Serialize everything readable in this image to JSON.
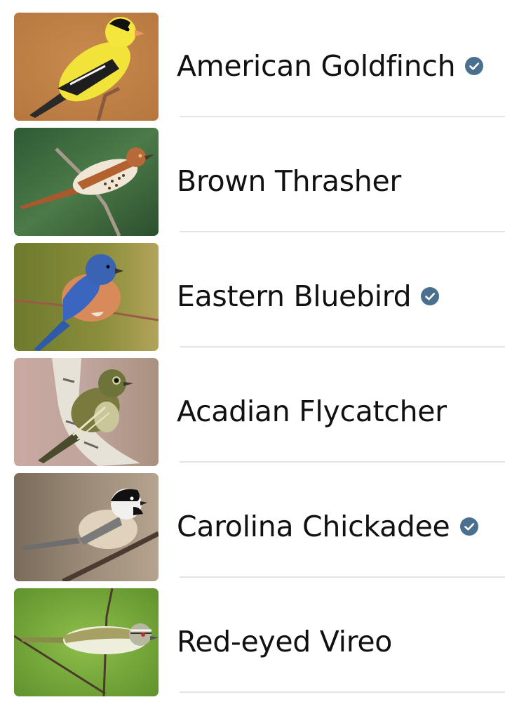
{
  "colors": {
    "verified_badge": "#4a6f8f",
    "separator": "#e4e4e7",
    "text": "#111111"
  },
  "birds": [
    {
      "name": "American Goldfinch",
      "verified": true,
      "photo": "goldfinch-photo"
    },
    {
      "name": "Brown Thrasher",
      "verified": false,
      "photo": "thrasher-photo"
    },
    {
      "name": "Eastern Bluebird",
      "verified": true,
      "photo": "bluebird-photo"
    },
    {
      "name": "Acadian Flycatcher",
      "verified": false,
      "photo": "flycatcher-photo"
    },
    {
      "name": "Carolina Chickadee",
      "verified": true,
      "photo": "chickadee-photo"
    },
    {
      "name": "Red-eyed Vireo",
      "verified": false,
      "photo": "vireo-photo"
    }
  ]
}
